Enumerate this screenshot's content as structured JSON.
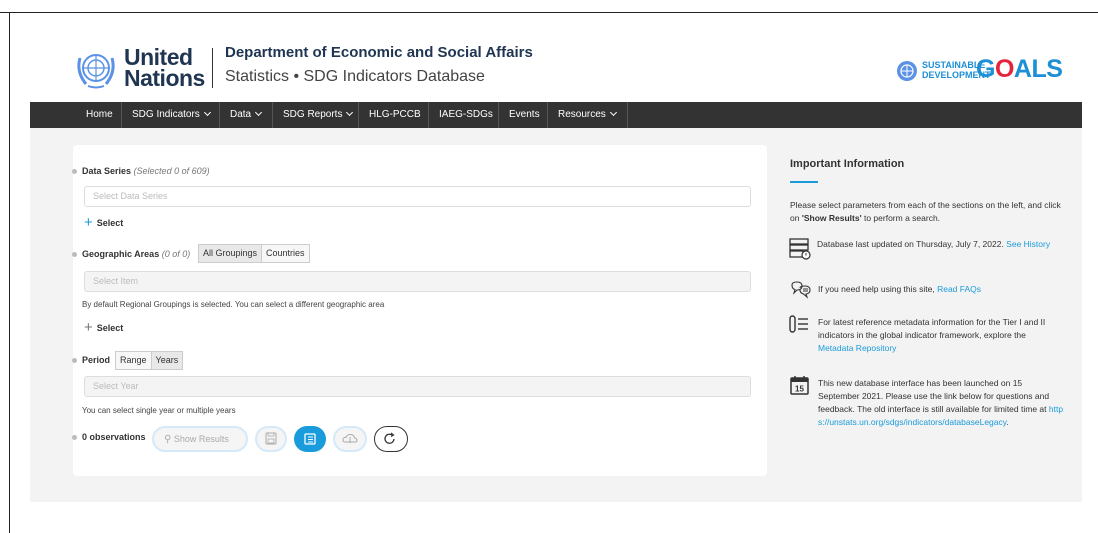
{
  "header": {
    "un_line1": "United",
    "un_line2": "Nations",
    "dept_title": "Department of Economic and Social Affairs",
    "dept_subtitle": "Statistics • SDG Indicators Database",
    "sdg_small_line1": "SUSTAINABLE",
    "sdg_small_line2": "DEVELOPMENT",
    "sdg_goals_g": "G",
    "sdg_goals_o": "O",
    "sdg_goals_rest": "ALS"
  },
  "nav": {
    "items": [
      {
        "label": "Home"
      },
      {
        "label": "SDG Indicators"
      },
      {
        "label": "Data"
      },
      {
        "label": "SDG Reports"
      },
      {
        "label": "HLG-PCCB"
      },
      {
        "label": "IAEG-SDGs"
      },
      {
        "label": "Events"
      },
      {
        "label": "Resources"
      }
    ]
  },
  "form": {
    "data_series_label": "Data Series",
    "data_series_count": "(Selected 0 of 609)",
    "data_series_placeholder": "Select Data Series",
    "select_label": "Select",
    "geo_label": "Geographic Areas",
    "geo_count": "(0 of 0)",
    "geo_tab_groupings": "All Groupings",
    "geo_tab_countries": "Countries",
    "geo_placeholder": "Select Item",
    "geo_note": "By default Regional Groupings is selected. You can select a different geographic area",
    "period_label": "Period",
    "period_tab_range": "Range",
    "period_tab_years": "Years",
    "period_placeholder": "Select Year",
    "period_note": "You can select single year or multiple years",
    "observations": "0 observations",
    "show_results": "Show Results"
  },
  "info": {
    "title": "Important Information",
    "intro_pre": "Please select parameters from each of the sections on the left, and click on ",
    "intro_bold": "'Show Results'",
    "intro_post": " to perform a search.",
    "updated_text": "Database last updated on Thursday, July 7, 2022. ",
    "updated_link": "See History",
    "faq_text": "If you need help using this site, ",
    "faq_link": "Read FAQs",
    "metadata_text": "For latest reference metadata information for the Tier I and II indicators in the global indicator framework, explore the ",
    "metadata_link": "Metadata Repository",
    "launch_text": "This new database interface has been launched on 15 September 2021. Please use the link below for questions and feedback. The old interface is still available for limited time at ",
    "launch_link": "https://unstats.un.org/sdgs/indicators/databaseLegacy",
    "launch_end": ".",
    "calendar_day": "15"
  },
  "colors": {
    "accent": "#1a9bdb",
    "navbar": "#333333",
    "un_blue": "#5b92e5",
    "goals_red": "#e5243b"
  }
}
